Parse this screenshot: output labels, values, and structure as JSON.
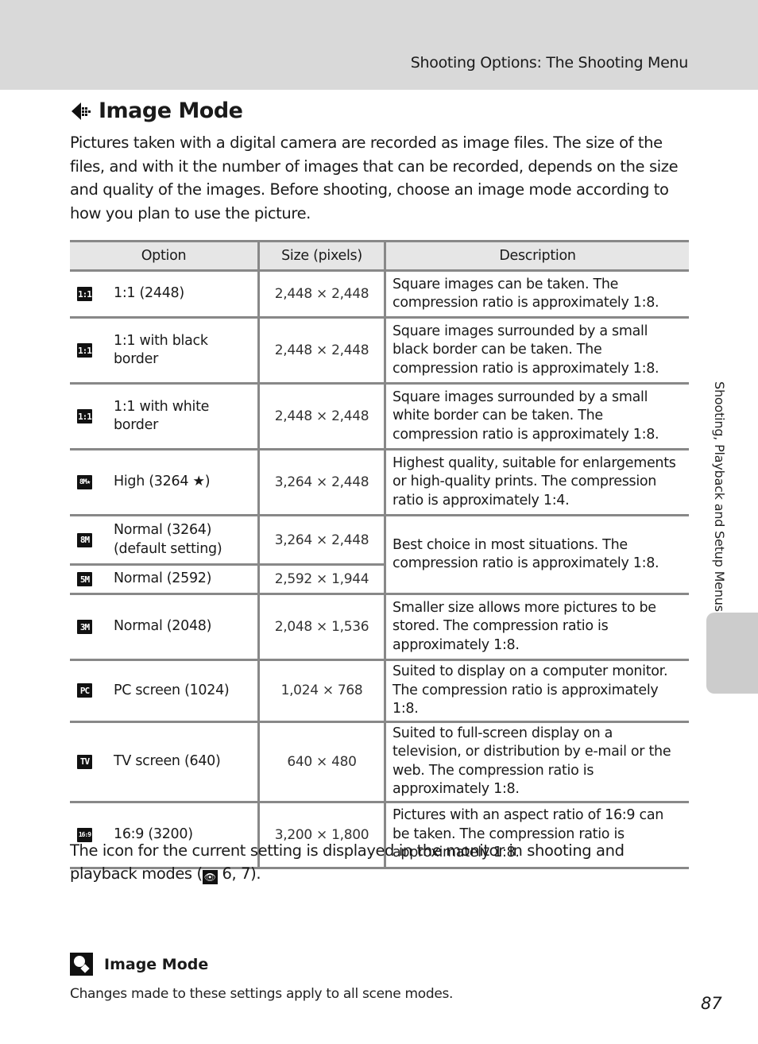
{
  "header": {
    "title": "Shooting Options: The Shooting Menu"
  },
  "page": {
    "title": "Image Mode",
    "title_icon": "image-mode-icon",
    "intro": "Pictures taken with a digital camera are recorded as image files. The size of the files, and with it the number of images that can be recorded, depends on the size and quality of the images. Before shooting, choose an image mode according to how you plan to use the picture."
  },
  "table": {
    "headers": [
      "Option",
      "Size (pixels)",
      "Description"
    ],
    "rows": [
      {
        "icon": "1:1",
        "icon_name": "square-1-1-icon",
        "option": "1:1 (2448)",
        "size": "2,448 × 2,448",
        "description": "Square images can be taken. The compression ratio is approximately 1:8."
      },
      {
        "icon": "1:1",
        "icon_name": "square-1-1-black-border-icon",
        "option": "1:1 with black border",
        "size": "2,448 × 2,448",
        "description": "Square images surrounded by a  small black border can be taken. The compression ratio is approximately 1:8."
      },
      {
        "icon": "1:1",
        "icon_name": "square-1-1-white-border-icon",
        "option": "1:1 with white border",
        "size": "2,448 × 2,448",
        "description": "Square images surrounded by a  small white border can be taken. The compression ratio is approximately 1:8."
      },
      {
        "icon": "8M★",
        "icon_name": "8m-high-icon",
        "option": "High (3264 ★)",
        "size": "3,264 × 2,448",
        "description": "Highest quality, suitable for enlargements or high-quality prints. The compression ratio is approximately 1:4."
      },
      {
        "icon": "8M",
        "icon_name": "8m-normal-icon",
        "option": "Normal (3264) (default setting)",
        "size": "3,264 × 2,448",
        "description": "Best choice in most situations. The compression ratio is approximately 1:8."
      },
      {
        "icon": "5M",
        "icon_name": "5m-normal-icon",
        "option": "Normal (2592)",
        "size": "2,592 × 1,944"
      },
      {
        "icon": "3M",
        "icon_name": "3m-normal-icon",
        "option": "Normal (2048)",
        "size": "2,048 × 1,536",
        "description": "Smaller size allows more pictures to be stored. The compression ratio is approximately 1:8."
      },
      {
        "icon": "PC",
        "icon_name": "pc-screen-icon",
        "option": "PC screen (1024)",
        "size": "1,024 × 768",
        "description": "Suited to display on a computer monitor. The compression ratio is approximately 1:8."
      },
      {
        "icon": "TV",
        "icon_name": "tv-screen-icon",
        "option": "TV screen (640)",
        "size": "640 × 480",
        "description": "Suited to full-screen display on a television, or distribution by e-mail or the web. The compression ratio is approximately 1:8."
      },
      {
        "icon": "16:9",
        "icon_name": "16-9-icon",
        "option": "16:9 (3200)",
        "size": "3,200 × 1,800",
        "description": "Pictures with an aspect ratio of 16:9 can be taken. The compression ratio is approximately 1:8."
      }
    ]
  },
  "note": {
    "before": "The icon for the current setting is displayed in the monitor in shooting and playback modes (",
    "ref_icon": "eye-reference-icon",
    "after": " 6, 7)."
  },
  "subsection": {
    "icon": "lightbulb-icon",
    "title": "Image Mode",
    "text": "Changes made to these settings apply to all scene modes."
  },
  "sidebar": {
    "label": "Shooting, Playback and Setup Menus"
  },
  "page_number": "87"
}
